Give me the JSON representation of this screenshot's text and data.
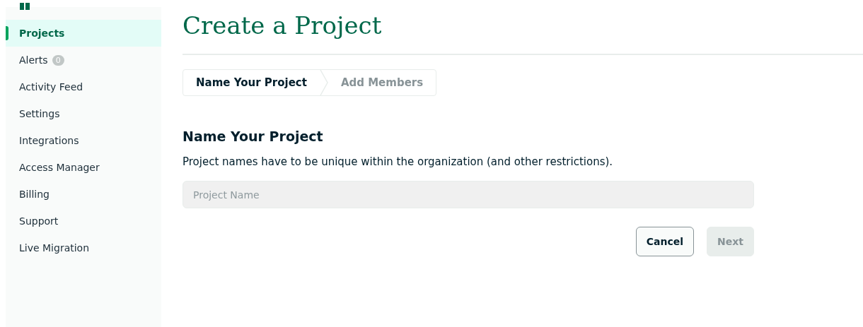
{
  "sidebar": {
    "items": [
      {
        "label": "Projects",
        "selected": true
      },
      {
        "label": "Alerts",
        "selected": false,
        "badge": "0"
      },
      {
        "label": "Activity Feed",
        "selected": false
      },
      {
        "label": "Settings",
        "selected": false
      },
      {
        "label": "Integrations",
        "selected": false
      },
      {
        "label": "Access Manager",
        "selected": false
      },
      {
        "label": "Billing",
        "selected": false
      },
      {
        "label": "Support",
        "selected": false
      },
      {
        "label": "Live Migration",
        "selected": false
      }
    ]
  },
  "page": {
    "title": "Create a Project"
  },
  "steps": [
    {
      "label": "Name Your Project",
      "selected": true
    },
    {
      "label": "Add Members",
      "selected": false
    }
  ],
  "section": {
    "heading": "Name Your Project",
    "description": "Project names have to be unique within the organization (and other restrictions).",
    "field": {
      "placeholder": "Project Name"
    }
  },
  "buttons": [
    {
      "label": "Cancel",
      "disabled": false
    },
    {
      "label": "Next",
      "disabled": true
    }
  ]
}
